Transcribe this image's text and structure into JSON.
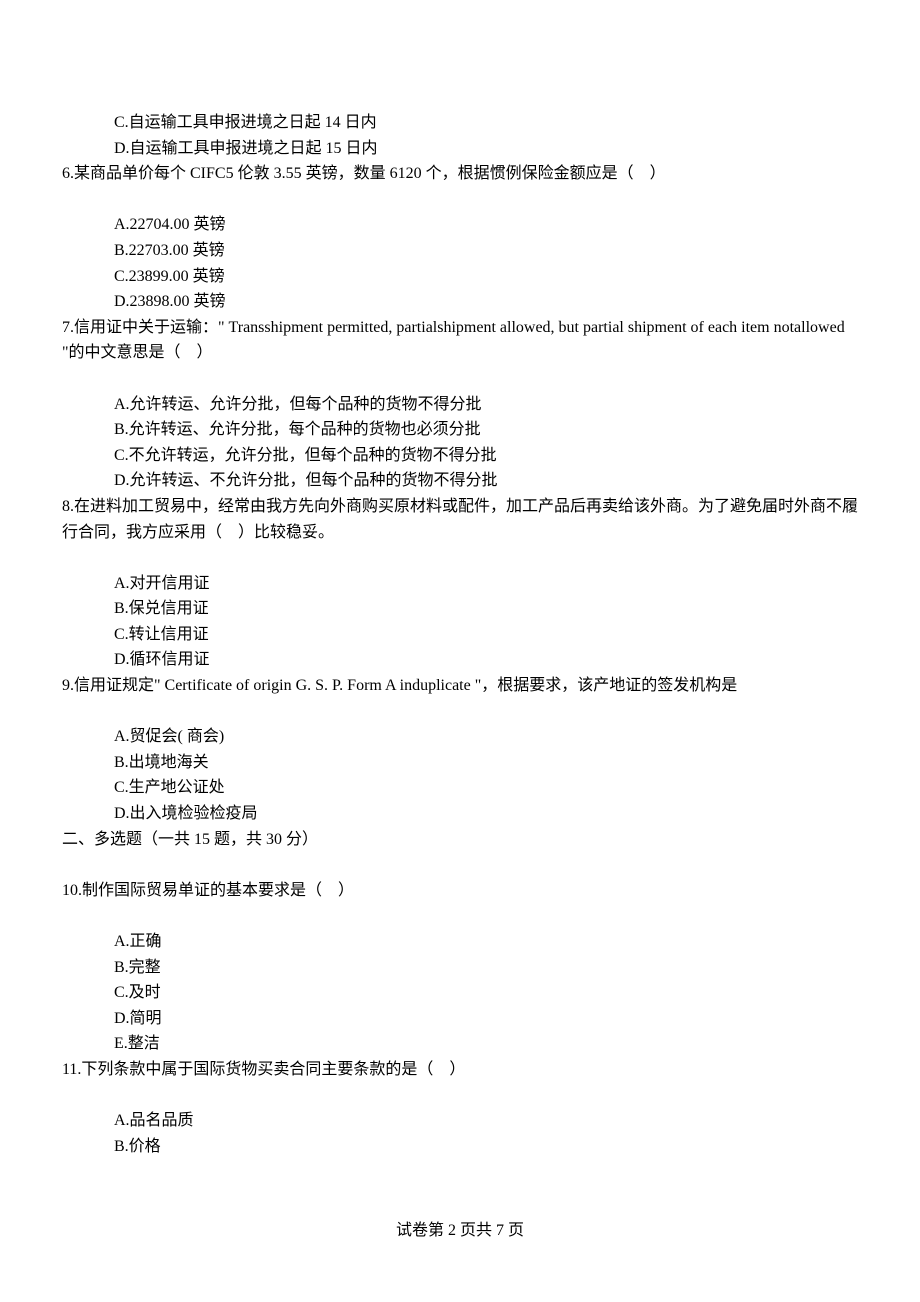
{
  "q5_options": {
    "C": "C.自运输工具申报进境之日起 14 日内",
    "D": "D.自运输工具申报进境之日起 15 日内"
  },
  "q6": {
    "stem": "6.某商品单价每个 CIFC5 伦敦 3.55 英镑，数量 6120 个，根据惯例保险金额应是（　）",
    "A": "A.22704.00 英镑",
    "B": "B.22703.00 英镑",
    "C": "C.23899.00 英镑",
    "D": "D.23898.00 英镑"
  },
  "q7": {
    "stem": "7.信用证中关于运输：\" Transshipment permitted, partialshipment allowed, but partial shipment of each item notallowed \"的中文意思是（　）",
    "A": "A.允许转运、允许分批，但每个品种的货物不得分批",
    "B": "B.允许转运、允许分批，每个品种的货物也必须分批",
    "C": "C.不允许转运，允许分批，但每个品种的货物不得分批",
    "D": "D.允许转运、不允许分批，但每个品种的货物不得分批"
  },
  "q8": {
    "stem": "8.在进料加工贸易中，经常由我方先向外商购买原材料或配件，加工产品后再卖给该外商。为了避免届时外商不履行合同，我方应采用（　）比较稳妥。",
    "A": "A.对开信用证",
    "B": "B.保兑信用证",
    "C": "C.转让信用证",
    "D": "D.循环信用证"
  },
  "q9": {
    "stem": "9.信用证规定\" Certificate of origin G. S. P. Form A induplicate \"，根据要求，该产地证的签发机构是",
    "A": "A.贸促会( 商会)",
    "B": "B.出境地海关",
    "C": "C.生产地公证处",
    "D": "D.出入境检验检疫局"
  },
  "section2": "二、多选题（一共 15 题，共 30 分）",
  "q10": {
    "stem": "10.制作国际贸易单证的基本要求是（　）",
    "A": "A.正确",
    "B": "B.完整",
    "C": "C.及时",
    "D": "D.简明",
    "E": "E.整洁"
  },
  "q11": {
    "stem": "11.下列条款中属于国际货物买卖合同主要条款的是（　）",
    "A": "A.品名品质",
    "B": "B.价格"
  },
  "footer": "试卷第 2 页共 7 页"
}
